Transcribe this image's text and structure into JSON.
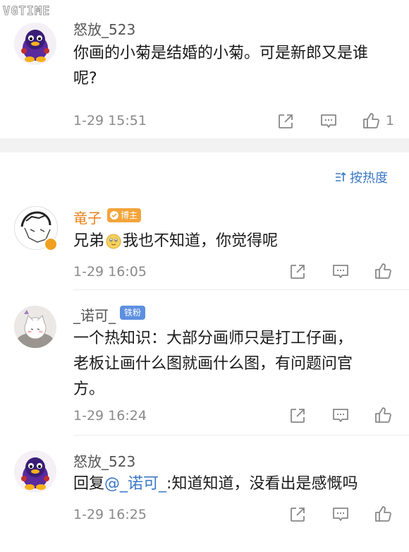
{
  "watermark": "VGTIME",
  "sort_label": "按热度",
  "badge_blogger": "博主",
  "badge_fan": "铁粉",
  "top_comment": {
    "user": "怒放_523",
    "text_line1": "你画的小菊是结婚的小菊。可是新郎又是谁",
    "text_line2": "呢?",
    "time": "1-29 15:51",
    "likes": "1"
  },
  "replies": [
    {
      "user": "竜子",
      "text": "我也不知道，你觉得呢",
      "prefix": "兄弟",
      "time": "1-29 16:05"
    },
    {
      "user": "_诺可_",
      "text_line1": "一个热知识：大部分画师只是打工仔画，",
      "text_line2": "老板让画什么图就画什么图，有问题问官",
      "text_line3": "方。",
      "time": "1-29 16:24"
    },
    {
      "user": "怒放_523",
      "reply_prefix": "回复",
      "mention": "@_诺可_",
      "text": ":知道知道，没看出是感慨吗",
      "time": "1-29 16:25"
    }
  ],
  "colors": {
    "link": "#3b78c6",
    "blogger_badge": "#f3a43b",
    "fan_badge": "#5d8fe0",
    "separator": "#f2f2f2"
  }
}
